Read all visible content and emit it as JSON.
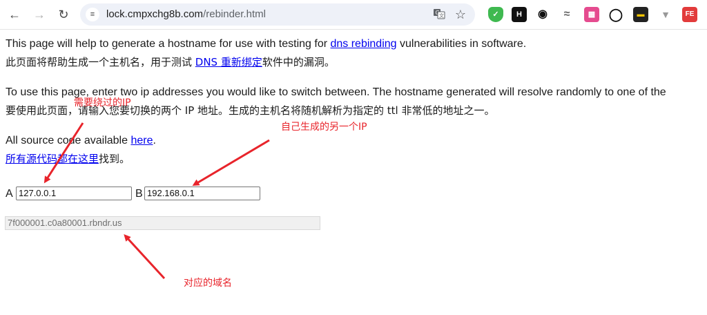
{
  "browser": {
    "url_host": "lock.cmpxchg8b.com",
    "url_path": "/rebinder.html",
    "back_icon": "arrow-left-icon",
    "forward_icon": "arrow-right-icon",
    "reload_icon": "reload-icon",
    "site_info_icon": "tune-icon",
    "translate_icon": "translate-icon",
    "bookmark_icon": "star-icon",
    "extensions": [
      "shield-extension-icon",
      "h-extension-icon",
      "hat-extension-icon",
      "swirl-extension-icon",
      "picture-extension-icon",
      "ring-extension-icon",
      "terminal-extension-icon",
      "v-extension-icon",
      "fe-extension-icon"
    ]
  },
  "page": {
    "intro_en_pre": "This page will help to generate a hostname for use with testing for ",
    "intro_en_link": "dns rebinding",
    "intro_en_post": " vulnerabilities in software.",
    "intro_zh_pre": "此页面将帮助生成一个主机名，用于测试 ",
    "intro_zh_link": "DNS 重新绑定",
    "intro_zh_post": "软件中的漏洞。",
    "usage_en": "To use this page, enter two ip addresses you would like to switch between. The hostname generated will resolve randomly to one of the",
    "usage_zh": "要使用此页面，请输入您要切换的两个 IP 地址。生成的主机名将随机解析为指定的 ttl 非常低的地址之一。",
    "source_en_pre": "All source code available ",
    "source_en_link": "here",
    "source_en_post": ".",
    "source_zh_link": "所有源代码都在这里",
    "source_zh_post": "找到。",
    "label_a": "A",
    "value_a": "127.0.0.1",
    "label_b": "B",
    "value_b": "192.168.0.1",
    "hostname": "7f000001.c0a80001.rbndr.us"
  },
  "annotations": {
    "ip_to_bypass": "需要绕过的IP",
    "own_ip": "自己生成的另一个IP",
    "domain": "对应的域名",
    "color": "#e8242b"
  }
}
